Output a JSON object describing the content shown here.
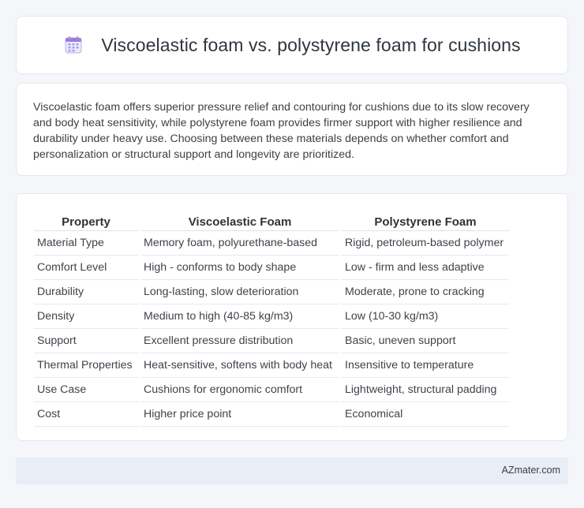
{
  "header": {
    "title": "Viscoelastic foam vs. polystyrene foam for cushions",
    "icon": "calendar-icon",
    "icon_color": "#7b6cd9"
  },
  "summary": {
    "text": "Viscoelastic foam offers superior pressure relief and contouring for cushions due to its slow recovery and body heat sensitivity, while polystyrene foam provides firmer support with higher resilience and durability under heavy use. Choosing between these materials depends on whether comfort and personalization or structural support and longevity are prioritized."
  },
  "table": {
    "headers": [
      "Property",
      "Viscoelastic Foam",
      "Polystyrene Foam"
    ],
    "rows": [
      [
        "Material Type",
        "Memory foam, polyurethane-based",
        "Rigid, petroleum-based polymer"
      ],
      [
        "Comfort Level",
        "High - conforms to body shape",
        "Low - firm and less adaptive"
      ],
      [
        "Durability",
        "Long-lasting, slow deterioration",
        "Moderate, prone to cracking"
      ],
      [
        "Density",
        "Medium to high (40-85 kg/m3)",
        "Low (10-30 kg/m3)"
      ],
      [
        "Support",
        "Excellent pressure distribution",
        "Basic, uneven support"
      ],
      [
        "Thermal Properties",
        "Heat-sensitive, softens with body heat",
        "Insensitive to temperature"
      ],
      [
        "Use Case",
        "Cushions for ergonomic comfort",
        "Lightweight, structural padding"
      ],
      [
        "Cost",
        "Higher price point",
        "Economical"
      ]
    ]
  },
  "footer": {
    "brand": "AZmater.com"
  }
}
